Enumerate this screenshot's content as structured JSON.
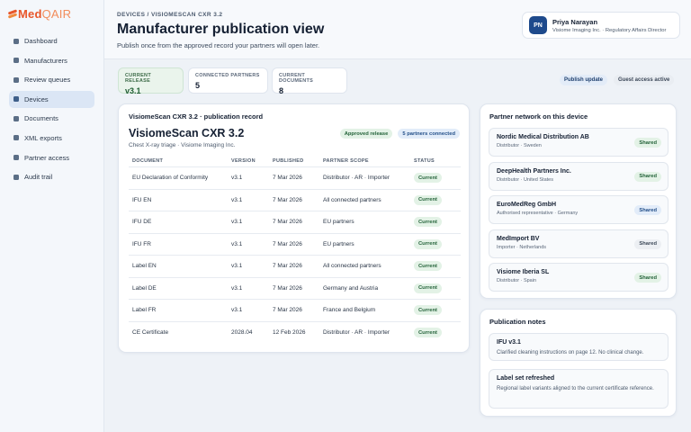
{
  "app": {
    "logo_main": "Med",
    "logo_accent": "QAIR"
  },
  "sidebar": {
    "items": [
      {
        "label": "Dashboard",
        "active": false
      },
      {
        "label": "Manufacturers",
        "active": false
      },
      {
        "label": "Review queues",
        "active": false
      },
      {
        "label": "Devices",
        "active": true
      },
      {
        "label": "Documents",
        "active": false
      },
      {
        "label": "XML exports",
        "active": false
      },
      {
        "label": "Partner access",
        "active": false
      },
      {
        "label": "Audit trail",
        "active": false
      }
    ]
  },
  "header": {
    "breadcrumb": "DEVICES / VISIOMESCAN CXR 3.2",
    "title": "Manufacturer publication view",
    "subtitle": "Publish once from the approved record your partners will open later."
  },
  "user": {
    "initials": "PN",
    "name": "Priya Narayan",
    "role": "Visiome Imaging Inc. · Regulatory Affairs Director"
  },
  "stats": [
    {
      "label": "CURRENT RELEASE",
      "value": "v3.1"
    },
    {
      "label": "CONNECTED PARTNERS",
      "value": "5"
    },
    {
      "label": "CURRENT DOCUMENTS",
      "value": "8"
    }
  ],
  "actions": {
    "publish": "Publish update",
    "guest": "Guest access active"
  },
  "record": {
    "heading": "VisiomeScan CXR 3.2 · publication record",
    "device_name": "VisiomeScan CXR 3.2",
    "device_sub": "Chest X-ray triage · Visiome Imaging Inc.",
    "badge_release": "Approved release",
    "badge_partners": "5 partners connected",
    "columns": [
      "DOCUMENT",
      "VERSION",
      "PUBLISHED",
      "PARTNER SCOPE",
      "STATUS"
    ],
    "rows": [
      {
        "document": "EU Declaration of Conformity",
        "version": "v3.1",
        "published": "7 Mar 2026",
        "scope": "Distributor · AR · Importer",
        "status": "Current"
      },
      {
        "document": "IFU EN",
        "version": "v3.1",
        "published": "7 Mar 2026",
        "scope": "All connected partners",
        "status": "Current"
      },
      {
        "document": "IFU DE",
        "version": "v3.1",
        "published": "7 Mar 2026",
        "scope": "EU partners",
        "status": "Current"
      },
      {
        "document": "IFU FR",
        "version": "v3.1",
        "published": "7 Mar 2026",
        "scope": "EU partners",
        "status": "Current"
      },
      {
        "document": "Label EN",
        "version": "v3.1",
        "published": "7 Mar 2026",
        "scope": "All connected partners",
        "status": "Current"
      },
      {
        "document": "Label DE",
        "version": "v3.1",
        "published": "7 Mar 2026",
        "scope": "Germany and Austria",
        "status": "Current"
      },
      {
        "document": "Label FR",
        "version": "v3.1",
        "published": "7 Mar 2026",
        "scope": "France and Belgium",
        "status": "Current"
      },
      {
        "document": "CE Certificate",
        "version": "2028.04",
        "published": "12 Feb 2026",
        "scope": "Distributor · AR · Importer",
        "status": "Current"
      }
    ]
  },
  "partners": {
    "title": "Partner network on this device",
    "items": [
      {
        "name": "Nordic Medical Distribution AB",
        "meta": "Distributor · Sweden",
        "status": "Shared"
      },
      {
        "name": "DeepHealth Partners Inc.",
        "meta": "Distributor · United States",
        "status": "Shared"
      },
      {
        "name": "EuroMedReg GmbH",
        "meta": "Authorised representative · Germany",
        "status": "Shared"
      },
      {
        "name": "MedImport BV",
        "meta": "Importer · Netherlands",
        "status": "Shared"
      },
      {
        "name": "Visiome Iberia SL",
        "meta": "Distributor · Spain",
        "status": "Shared"
      }
    ]
  },
  "notes": {
    "title": "Publication notes",
    "items": [
      {
        "title": "IFU v3.1",
        "text": "Clarified cleaning instructions on page 12. No clinical change."
      },
      {
        "title": "Label set refreshed",
        "text": "Regional label variants aligned to the current certificate reference."
      }
    ]
  },
  "colors": {
    "accent": "#e8562a",
    "brand_blue": "#1e4a8c",
    "success": "#24633a"
  }
}
